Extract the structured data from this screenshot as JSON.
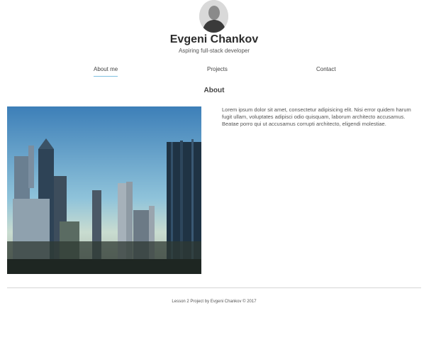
{
  "profile": {
    "name": "Evgeni Chankov",
    "tagline": "Aspiring full-stack developer"
  },
  "nav": {
    "items": [
      {
        "label": "About me",
        "active": true
      },
      {
        "label": "Projects",
        "active": false
      },
      {
        "label": "Contact",
        "active": false
      }
    ]
  },
  "about": {
    "title": "About",
    "text": "Lorem ipsum dolor sit amet, consectetur adipisicing elit. Nisi error quidem harum fugit ullam, voluptates adipisci odio quisquam, laborum architecto accusamus. Beatae porro qui ut accusamus corrupti architecto, eligendi molestiae."
  },
  "footer": {
    "text": "Lesson 2 Project by Evgeni Chankov © 2017"
  },
  "colors": {
    "accent_underline": "#7fc0e0",
    "divider": "#d6d6d6"
  }
}
